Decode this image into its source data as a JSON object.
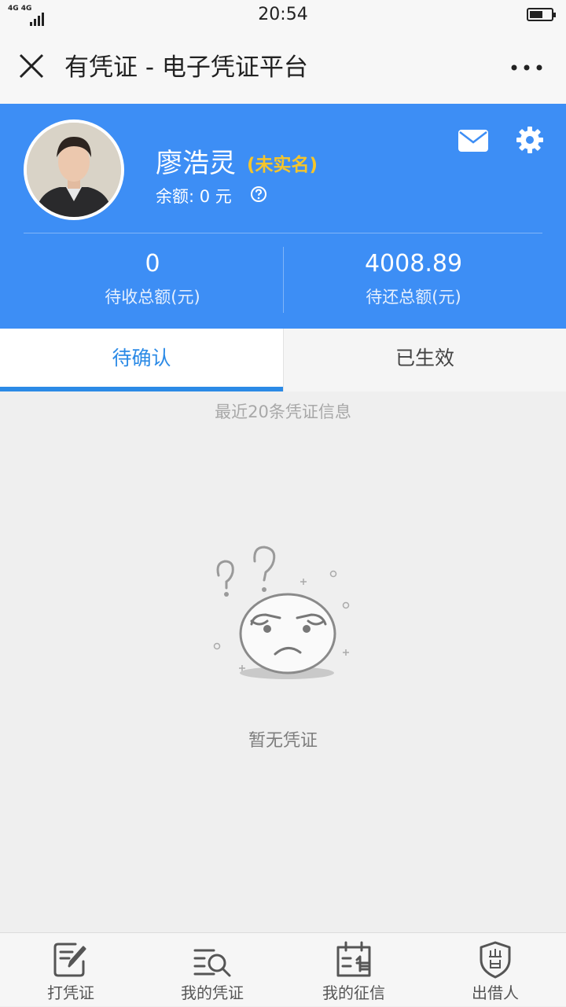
{
  "status_bar": {
    "network": "4G 4G",
    "time": "20:54"
  },
  "nav": {
    "title": "有凭证 - 电子凭证平台",
    "close_icon": "close-icon",
    "more_icon": "more-icon"
  },
  "profile": {
    "name": "廖浩灵",
    "verify_status": "(未实名)",
    "balance": "余额: 0 元",
    "stats": [
      {
        "value": "0",
        "label": "待收总额(元)"
      },
      {
        "value": "4008.89",
        "label": "待还总额(元)"
      }
    ],
    "icons": [
      "mail-icon",
      "gear-icon",
      "help-icon"
    ]
  },
  "tabs": [
    {
      "label": "待确认",
      "active": true
    },
    {
      "label": "已生效",
      "active": false
    }
  ],
  "list_caption": "最近20条凭证信息",
  "empty_state": {
    "text": "暂无凭证",
    "icon": "confused-face-icon"
  },
  "bottom_nav": [
    {
      "label": "打凭证",
      "icon": "edit-document-icon"
    },
    {
      "label": "我的凭证",
      "icon": "search-list-icon"
    },
    {
      "label": "我的征信",
      "icon": "credit-record-icon"
    },
    {
      "label": "出借人",
      "icon": "lender-shield-icon"
    }
  ],
  "colors": {
    "brand_blue": "#3d8ef5",
    "tab_active": "#2b8ae6",
    "verify_yellow": "#f5c52b"
  }
}
